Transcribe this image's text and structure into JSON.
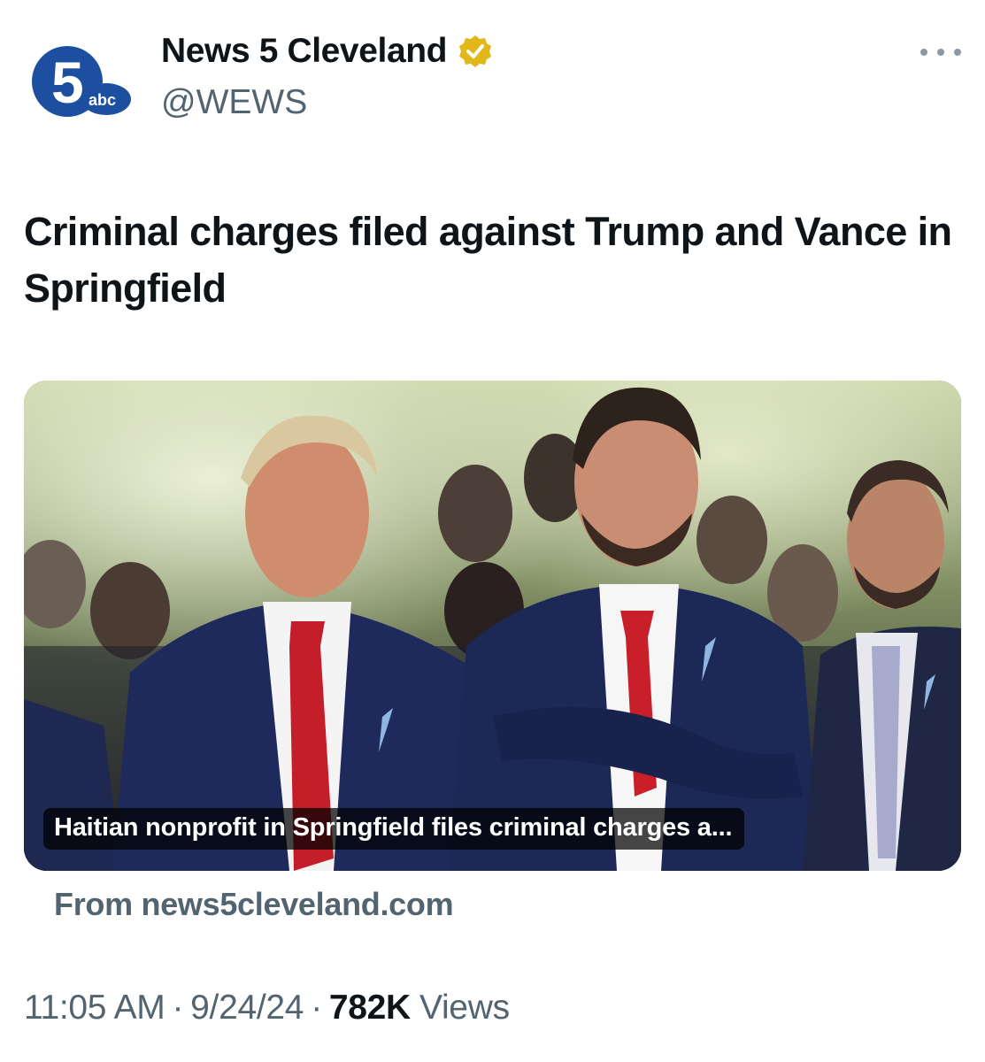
{
  "author": {
    "name": "News 5 Cleveland",
    "handle": "@WEWS",
    "avatar_text": "5",
    "avatar_sub": "abc",
    "verified_color": "#e2b719"
  },
  "tweet": {
    "text": "Criminal charges filed against Trump and Vance in Springfield"
  },
  "link_card": {
    "title": "Haitian nonprofit in Springfield files criminal charges a...",
    "source": "From news5cleveland.com"
  },
  "meta": {
    "time": "11:05 AM",
    "separator": "·",
    "date": "9/24/24",
    "views_count": "782K",
    "views_label": "Views"
  },
  "colors": {
    "text_primary": "#0f1419",
    "text_secondary": "#536471",
    "logo_blue": "#1d4fa0"
  }
}
